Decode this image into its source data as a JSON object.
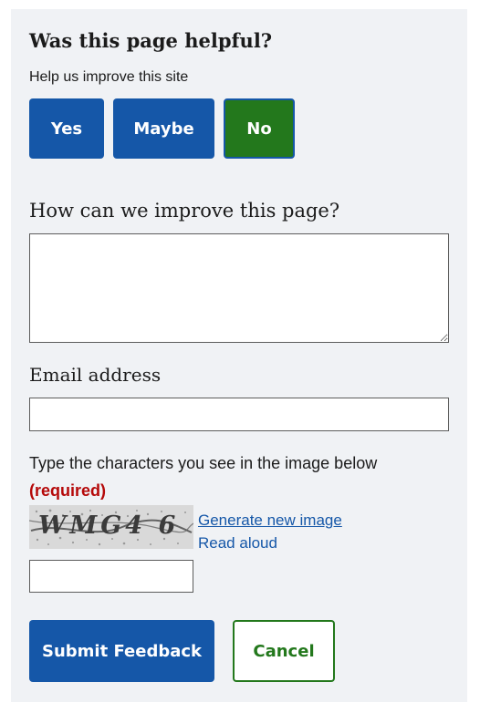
{
  "feedback": {
    "title": "Was this page helpful?",
    "subtitle": "Help us improve this site",
    "choices": {
      "yes": "Yes",
      "maybe": "Maybe",
      "no": "No"
    },
    "improve_label": "How can we improve this page?",
    "improve_value": "",
    "email_label": "Email address",
    "email_value": "",
    "captcha": {
      "label": "Type the characters you see in the image below",
      "required": "(required)",
      "image_text": "WMG4 6",
      "generate_link": "Generate new image",
      "read_aloud_link": "Read aloud",
      "input_value": ""
    },
    "actions": {
      "submit": "Submit Feedback",
      "cancel": "Cancel"
    }
  },
  "colors": {
    "panel_bg": "#f0f2f5",
    "primary_blue": "#1557a8",
    "primary_green": "#23781c",
    "required_red": "#b50909"
  },
  "icons": {
    "captcha": "captcha-image"
  }
}
